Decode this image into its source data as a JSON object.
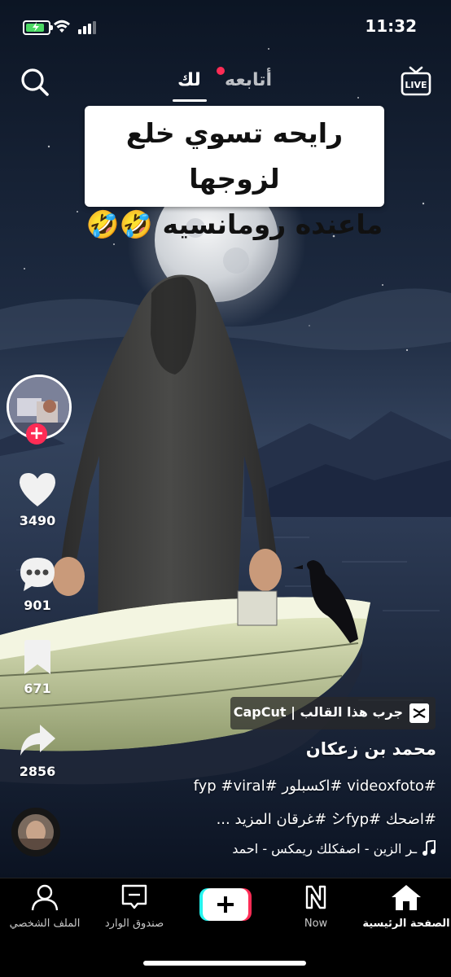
{
  "status_bar": {
    "time": "11:32"
  },
  "top_nav": {
    "tab_following": "أتابعه",
    "tab_for_you": "لك",
    "live_label": "LIVE"
  },
  "video_caption": {
    "line1": "رايحه تسوي خلع لزوجها",
    "line2": "ماعنده رومانسيه 🤣🤣"
  },
  "actions": {
    "likes": "3490",
    "comments": "901",
    "saves": "671",
    "shares": "2856"
  },
  "capcut": {
    "label": "جرب هذا القالب | CapCut"
  },
  "post": {
    "username": "محمد بن زعكان",
    "description_line1": "#videoxfoto #اكسبلور #fyp #viral",
    "description_line2": "#اضحك #シfyp #غرقان المزيد ...",
    "sound": "ـر الزين - اصفكلك ريمكس - احمد"
  },
  "bottom_nav": {
    "home": "الصفحة الرئيسية",
    "now": "Now",
    "inbox": "صندوق الوارد",
    "profile": "الملف الشخصي"
  },
  "colors": {
    "accent_red": "#fe2c55",
    "accent_cyan": "#25f4ee",
    "battery_green": "#4cd964"
  }
}
